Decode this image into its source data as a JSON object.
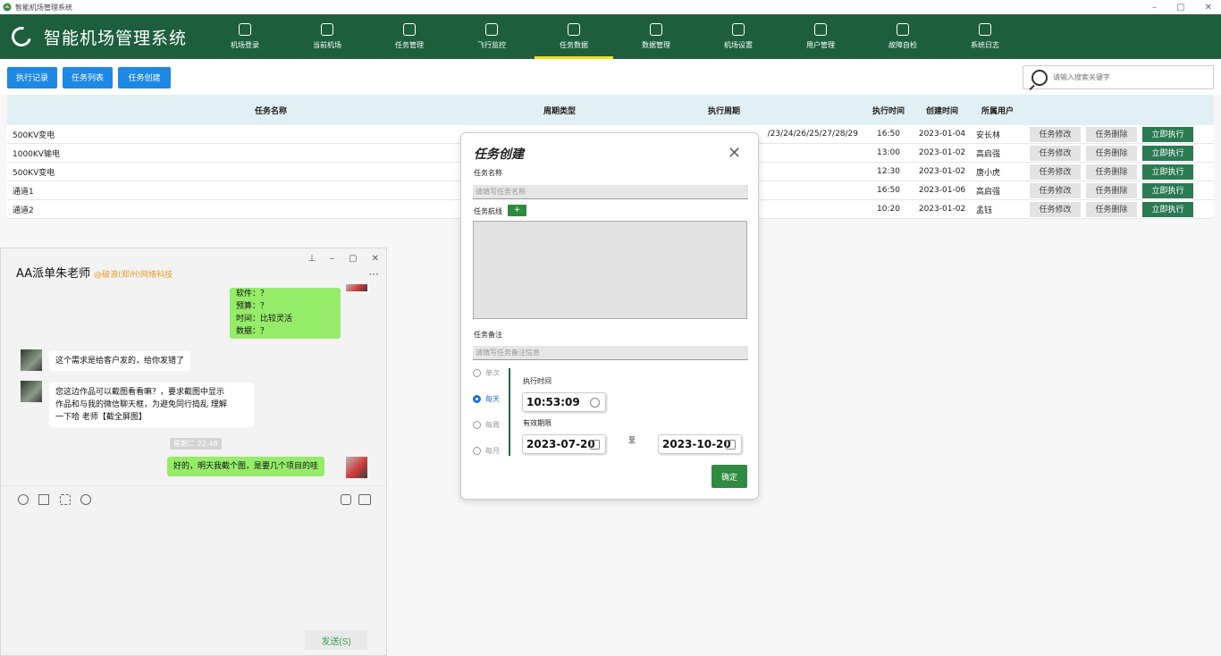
{
  "window": {
    "title": "智能机场管理系统",
    "ctrl_min": "–",
    "ctrl_max": "▢",
    "ctrl_close": "✕"
  },
  "header": {
    "logo_text": "智能机场管理系统",
    "nav": [
      {
        "label": "机场登录",
        "icon": "building-icon"
      },
      {
        "label": "当前机场",
        "icon": "drone-icon"
      },
      {
        "label": "任务管理",
        "icon": "task-icon"
      },
      {
        "label": "飞行监控",
        "icon": "flight-icon"
      },
      {
        "label": "任务数据",
        "icon": "doc-icon",
        "active": true
      },
      {
        "label": "数据管理",
        "icon": "location-icon"
      },
      {
        "label": "机场设置",
        "icon": "settings-icon"
      },
      {
        "label": "用户管理",
        "icon": "user-icon"
      },
      {
        "label": "故障自检",
        "icon": "check-icon"
      },
      {
        "label": "系统日志",
        "icon": "log-icon"
      }
    ]
  },
  "toolbar": {
    "btn1": "执行记录",
    "btn2": "任务列表",
    "btn3": "任务创建",
    "search_placeholder": "请输入搜索关键字"
  },
  "table": {
    "headers": {
      "name": "任务名称",
      "cycle": "周期类型",
      "period": "执行周期",
      "time": "执行时间",
      "created": "创建时间",
      "user": "所属用户"
    },
    "actions": {
      "edit": "任务修改",
      "delete": "任务删除",
      "run": "立即执行"
    },
    "rows": [
      {
        "name": "500KV变电",
        "period": "/23/24/26/25/27/28/29",
        "time": "16:50",
        "created": "2023-01-04",
        "user": "安长林"
      },
      {
        "name": "1000KV输电",
        "period": "",
        "time": "13:00",
        "created": "2023-01-02",
        "user": "高启强"
      },
      {
        "name": "500KV变电",
        "period": "",
        "time": "12:30",
        "created": "2023-01-02",
        "user": "唐小虎"
      },
      {
        "name": "通道1",
        "period": "",
        "time": "16:50",
        "created": "2023-01-06",
        "user": "高启强"
      },
      {
        "name": "通道2",
        "period": "",
        "time": "10:20",
        "created": "2023-01-02",
        "user": "孟钰"
      }
    ]
  },
  "chat": {
    "name": "AA派单朱老师",
    "org": "@破浪(郑州)网络科技",
    "pin": "⊥",
    "min": "–",
    "max": "▢",
    "close": "✕",
    "more": "···",
    "msg1": [
      "软件：？",
      "预算：？",
      "时间：比较灵活",
      "数据：？"
    ],
    "msg2": "这个需求是给客户发的，给你发错了",
    "msg3": [
      "您这边作品可以截图看看嘛？，要求截图中显示",
      "作品和与我的微信聊天框，为避免同行捣乱 理解",
      "一下哈  老师【截全屏图】"
    ],
    "timestamp": "星期二 22:48",
    "msg4": "好的，明天我截个图，是要几个项目的哇",
    "send": "发送(S)"
  },
  "dialog": {
    "title": "任务创建",
    "close": "✕",
    "name_label": "任务名称",
    "name_placeholder": "请填写任务名称",
    "route_label": "任务航线",
    "add": "+",
    "note_label": "任务备注",
    "note_placeholder": "请填写任务备注信息",
    "radios": [
      {
        "label": "单次",
        "on": false
      },
      {
        "label": "每天",
        "on": true
      },
      {
        "label": "每周",
        "on": false
      },
      {
        "label": "每月",
        "on": false
      }
    ],
    "exec_time_label": "执行时间",
    "exec_time": "10:53:09",
    "valid_label": "有效期限",
    "date_from": "2023-07-20",
    "to": "至",
    "date_to": "2023-10-20",
    "ok": "确定"
  }
}
